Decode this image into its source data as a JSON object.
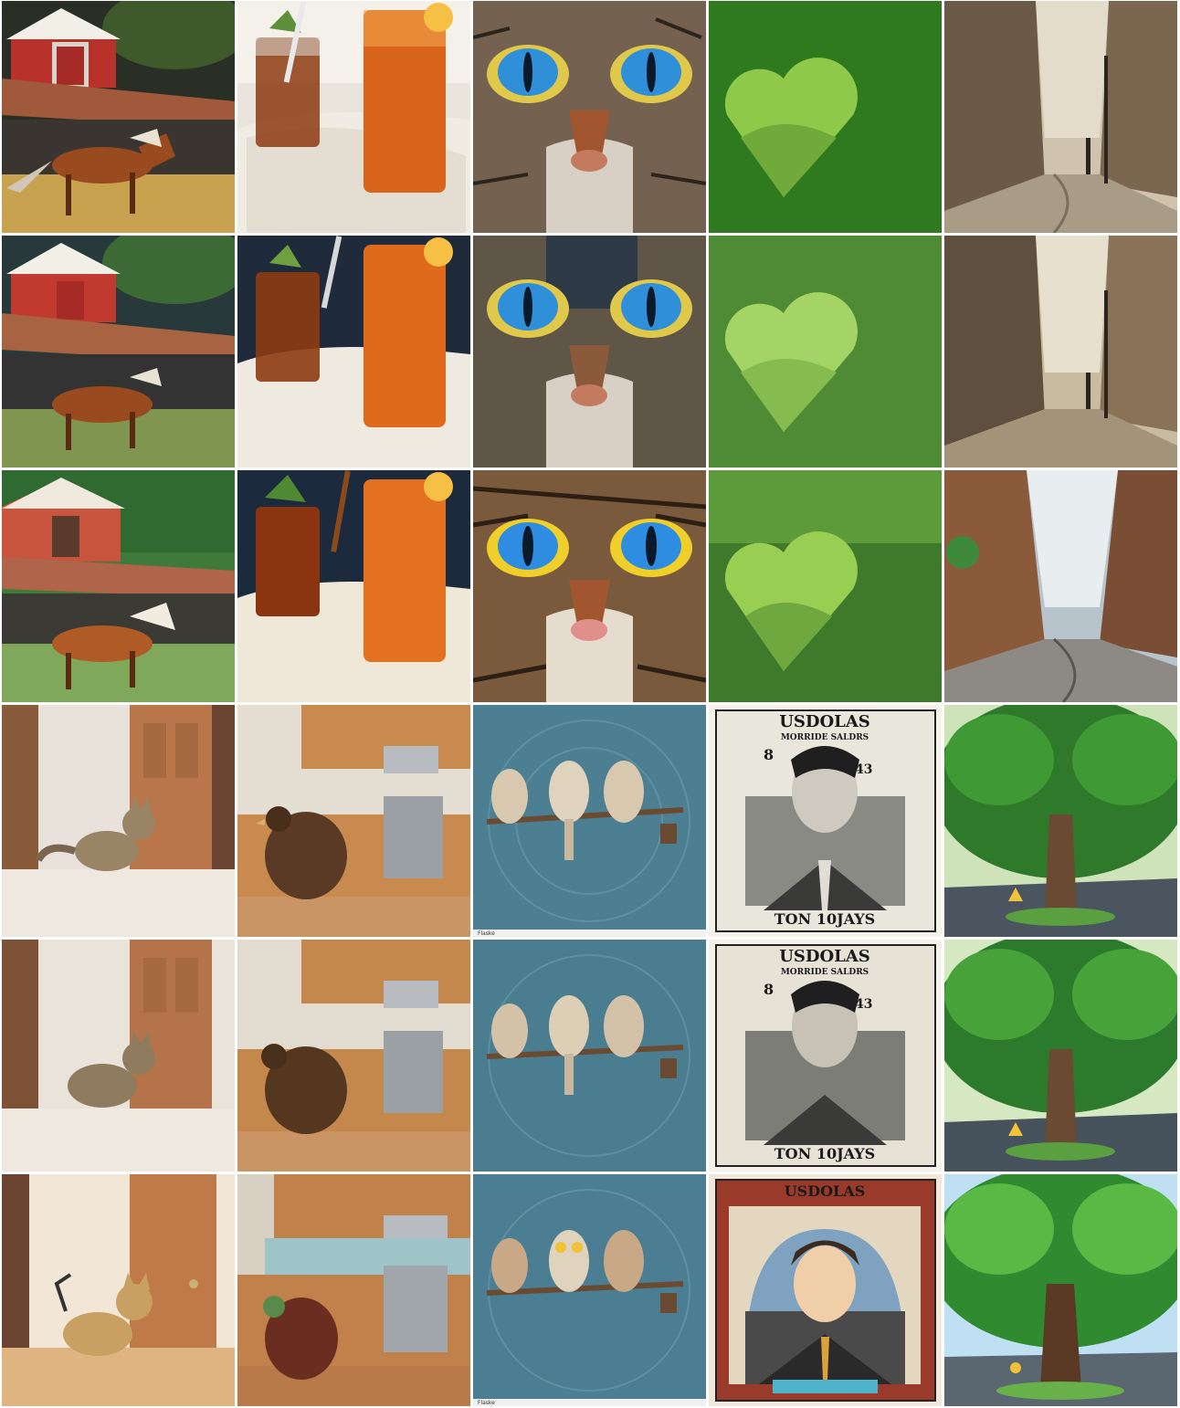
{
  "layout": {
    "rows": 6,
    "columns": 5,
    "description_note": ""
  },
  "tiles": [
    {
      "row": 1,
      "col": 1,
      "subject": "barn-horse",
      "style": "painting"
    },
    {
      "row": 1,
      "col": 2,
      "subject": "iced-tea",
      "style": "photo"
    },
    {
      "row": 1,
      "col": 3,
      "subject": "cat-eyes",
      "style": "photo"
    },
    {
      "row": 1,
      "col": 4,
      "subject": "green-heart",
      "style": "photo"
    },
    {
      "row": 1,
      "col": 5,
      "subject": "street",
      "style": "painting"
    },
    {
      "row": 2,
      "col": 1,
      "subject": "barn-horse",
      "style": "painting"
    },
    {
      "row": 2,
      "col": 2,
      "subject": "iced-tea",
      "style": "photo"
    },
    {
      "row": 2,
      "col": 3,
      "subject": "cat-eyes",
      "style": "painting"
    },
    {
      "row": 2,
      "col": 4,
      "subject": "green-heart",
      "style": "painting"
    },
    {
      "row": 2,
      "col": 5,
      "subject": "street",
      "style": "painting"
    },
    {
      "row": 3,
      "col": 1,
      "subject": "barn-horse",
      "style": "anime"
    },
    {
      "row": 3,
      "col": 2,
      "subject": "iced-tea",
      "style": "illustration"
    },
    {
      "row": 3,
      "col": 3,
      "subject": "cat-eyes",
      "style": "illustration"
    },
    {
      "row": 3,
      "col": 4,
      "subject": "green-heart",
      "style": "illustration"
    },
    {
      "row": 3,
      "col": 5,
      "subject": "street",
      "style": "illustration"
    },
    {
      "row": 4,
      "col": 1,
      "subject": "cat-doorway",
      "style": "photo"
    },
    {
      "row": 4,
      "col": 2,
      "subject": "turkey-kitchen",
      "style": "photo"
    },
    {
      "row": 4,
      "col": 3,
      "subject": "owls",
      "style": "illustration"
    },
    {
      "row": 4,
      "col": 4,
      "subject": "dollar-bill",
      "style": "engraving"
    },
    {
      "row": 4,
      "col": 5,
      "subject": "tree-road",
      "style": "illustration"
    },
    {
      "row": 5,
      "col": 1,
      "subject": "cat-doorway",
      "style": "photo"
    },
    {
      "row": 5,
      "col": 2,
      "subject": "turkey-kitchen",
      "style": "photo"
    },
    {
      "row": 5,
      "col": 3,
      "subject": "owls",
      "style": "illustration"
    },
    {
      "row": 5,
      "col": 4,
      "subject": "dollar-bill",
      "style": "engraving"
    },
    {
      "row": 5,
      "col": 5,
      "subject": "tree-road",
      "style": "illustration"
    },
    {
      "row": 6,
      "col": 1,
      "subject": "cat-doorway",
      "style": "anime"
    },
    {
      "row": 6,
      "col": 2,
      "subject": "turkey-kitchen",
      "style": "illustration"
    },
    {
      "row": 6,
      "col": 3,
      "subject": "owls",
      "style": "illustration"
    },
    {
      "row": 6,
      "col": 4,
      "subject": "dollar-bill-anime",
      "style": "anime"
    },
    {
      "row": 6,
      "col": 5,
      "subject": "tree-road",
      "style": "anime"
    }
  ],
  "money": {
    "top_text": "USDOLAS",
    "top_subtext": "MORRIDE SALDRS",
    "bottom_text": "TON 10JAYS",
    "corner_num_a": "8",
    "corner_num_b": "43"
  },
  "owl_caption": "Flaske"
}
